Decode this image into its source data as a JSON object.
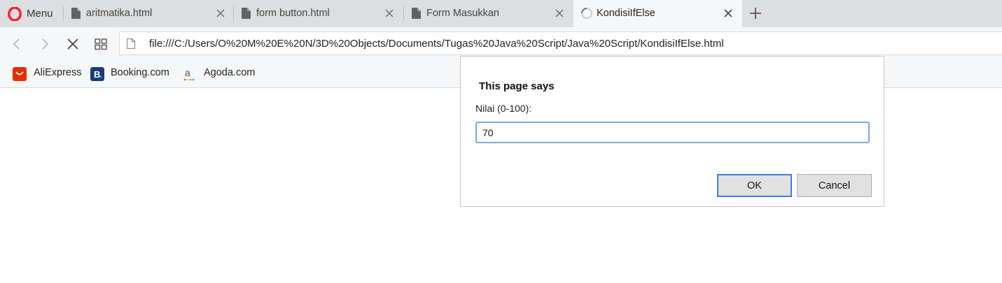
{
  "browser": {
    "menu_label": "Menu",
    "tabs": [
      {
        "title": "aritmatika.html",
        "active": false
      },
      {
        "title": "form button.html",
        "active": false
      },
      {
        "title": "Form Masukkan",
        "active": false
      },
      {
        "title": "KondisiIfElse",
        "active": true
      }
    ],
    "address": {
      "url": "file:///C:/Users/O%20M%20E%20N/3D%20Objects/Documents/Tugas%20Java%20Script/Java%20Script/KondisiIfElse.html"
    },
    "bookmarks": [
      {
        "label": "AliExpress",
        "icon": "aliexpress-icon",
        "color": "#e62e04"
      },
      {
        "label": "Booking.com",
        "icon": "booking-icon",
        "color": "#1b3d7a"
      },
      {
        "label": "Agoda.com",
        "icon": "agoda-icon",
        "color": "#777777"
      }
    ],
    "colors": {
      "opera_red": "#ff1b2d",
      "focus_blue": "#3c7fd6"
    }
  },
  "dialog": {
    "title": "This page says",
    "message": "Nilai (0-100):",
    "input_value": "70",
    "ok_label": "OK",
    "cancel_label": "Cancel"
  }
}
